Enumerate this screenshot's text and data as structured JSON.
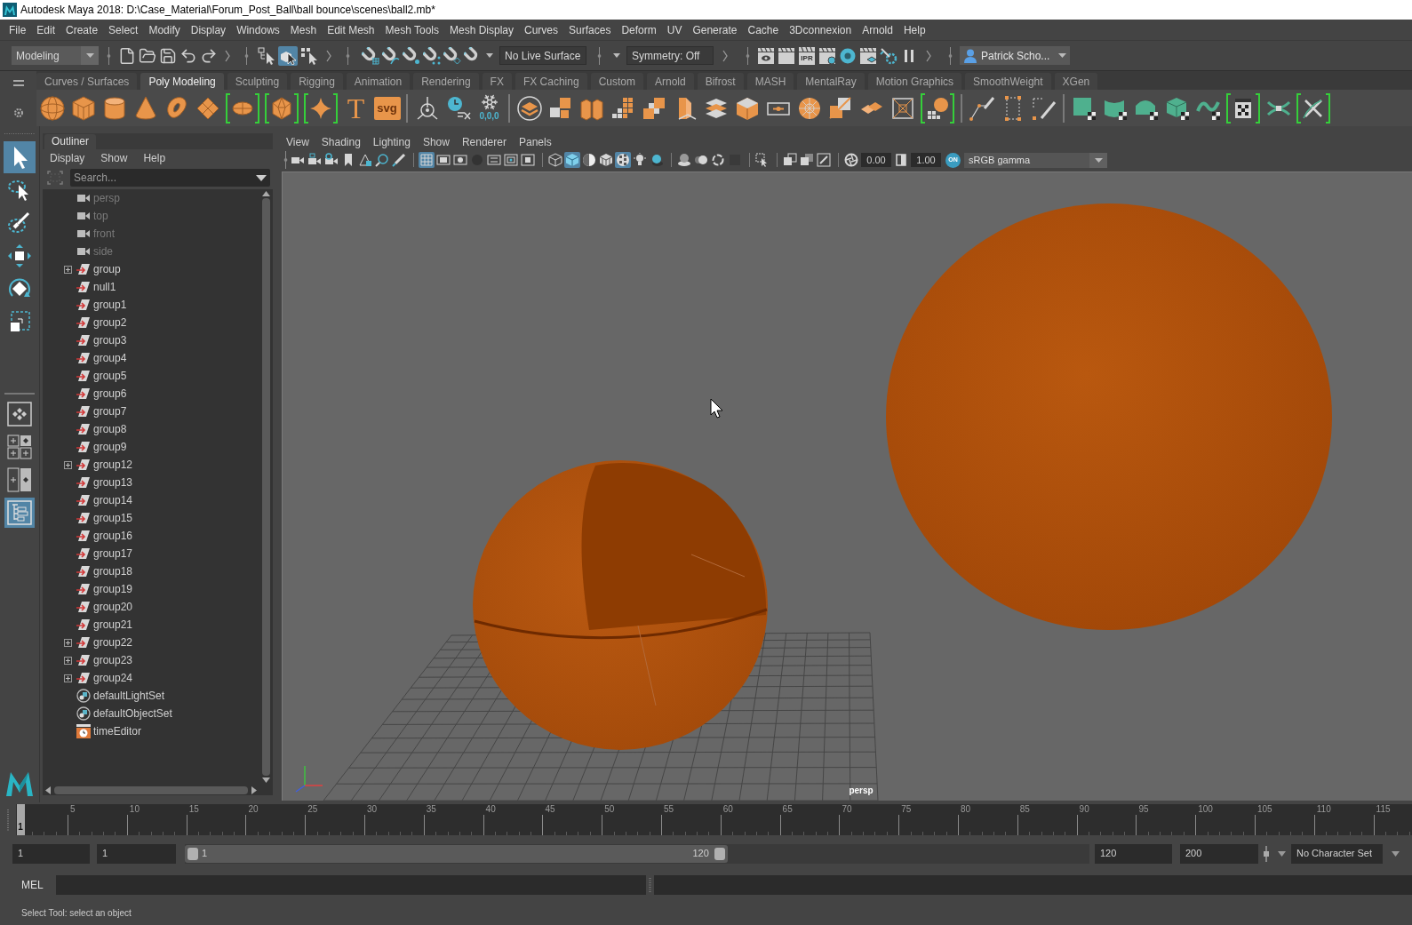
{
  "window": {
    "title": "Autodesk Maya 2018: D:\\Case_Material\\Forum_Post_Ball\\ball bounce\\scenes\\ball2.mb*"
  },
  "menu_bar": [
    "File",
    "Edit",
    "Create",
    "Select",
    "Modify",
    "Display",
    "Windows",
    "Mesh",
    "Edit Mesh",
    "Mesh Tools",
    "Mesh Display",
    "Curves",
    "Surfaces",
    "Deform",
    "UV",
    "Generate",
    "Cache",
    "3Dconnexion",
    "Arnold",
    "Help"
  ],
  "status_line": {
    "menu_set": "Modeling",
    "selection_modes": [
      {
        "selected": false
      },
      {
        "selected": true
      },
      {
        "selected": false
      }
    ],
    "live_surface": "No Live Surface",
    "symmetry": "Symmetry: Off",
    "ipr_label": "IPR",
    "user": "Patrick Scho..."
  },
  "shelf": {
    "tabs": [
      {
        "label": "Curves / Surfaces",
        "selected": false
      },
      {
        "label": "Poly Modeling",
        "selected": true
      },
      {
        "label": "Sculpting",
        "selected": false
      },
      {
        "label": "Rigging",
        "selected": false
      },
      {
        "label": "Animation",
        "selected": false
      },
      {
        "label": "Rendering",
        "selected": false
      },
      {
        "label": "FX",
        "selected": false
      },
      {
        "label": "FX Caching",
        "selected": false
      },
      {
        "label": "Custom",
        "selected": false
      },
      {
        "label": "Arnold",
        "selected": false
      },
      {
        "label": "Bifrost",
        "selected": false
      },
      {
        "label": "MASH",
        "selected": false
      },
      {
        "label": "MentalRay",
        "selected": false
      },
      {
        "label": "Motion Graphics",
        "selected": false
      },
      {
        "label": "SmoothWeight",
        "selected": false
      },
      {
        "label": "XGen",
        "selected": false
      }
    ],
    "button_labels": [
      "T",
      "svg",
      "0,0,0"
    ]
  },
  "toolbox": {
    "tools": [
      {
        "selected": true
      },
      {
        "selected": false
      },
      {
        "selected": false
      },
      {
        "selected": false
      },
      {
        "selected": false
      },
      {
        "selected": false
      }
    ],
    "layouts": [
      {
        "selected": false
      },
      {
        "selected": false
      },
      {
        "selected": false
      },
      {
        "selected": true
      }
    ]
  },
  "outliner": {
    "title": "Outliner",
    "menu": [
      "Display",
      "Show",
      "Help"
    ],
    "search": {
      "placeholder": "Search..."
    },
    "items": [
      {
        "label": "persp",
        "kind": "camera",
        "dimmed": true,
        "expandable": false
      },
      {
        "label": "top",
        "kind": "camera",
        "dimmed": true,
        "expandable": false
      },
      {
        "label": "front",
        "kind": "camera",
        "dimmed": true,
        "expandable": false
      },
      {
        "label": "side",
        "kind": "camera",
        "dimmed": true,
        "expandable": false
      },
      {
        "label": "group",
        "kind": "group",
        "dimmed": false,
        "expandable": true
      },
      {
        "label": "null1",
        "kind": "group",
        "dimmed": false,
        "expandable": false
      },
      {
        "label": "group1",
        "kind": "group",
        "dimmed": false,
        "expandable": false
      },
      {
        "label": "group2",
        "kind": "group",
        "dimmed": false,
        "expandable": false
      },
      {
        "label": "group3",
        "kind": "group",
        "dimmed": false,
        "expandable": false
      },
      {
        "label": "group4",
        "kind": "group",
        "dimmed": false,
        "expandable": false
      },
      {
        "label": "group5",
        "kind": "group",
        "dimmed": false,
        "expandable": false
      },
      {
        "label": "group6",
        "kind": "group",
        "dimmed": false,
        "expandable": false
      },
      {
        "label": "group7",
        "kind": "group",
        "dimmed": false,
        "expandable": false
      },
      {
        "label": "group8",
        "kind": "group",
        "dimmed": false,
        "expandable": false
      },
      {
        "label": "group9",
        "kind": "group",
        "dimmed": false,
        "expandable": false
      },
      {
        "label": "group12",
        "kind": "group",
        "dimmed": false,
        "expandable": true
      },
      {
        "label": "group13",
        "kind": "group",
        "dimmed": false,
        "expandable": false
      },
      {
        "label": "group14",
        "kind": "group",
        "dimmed": false,
        "expandable": false
      },
      {
        "label": "group15",
        "kind": "group",
        "dimmed": false,
        "expandable": false
      },
      {
        "label": "group16",
        "kind": "group",
        "dimmed": false,
        "expandable": false
      },
      {
        "label": "group17",
        "kind": "group",
        "dimmed": false,
        "expandable": false
      },
      {
        "label": "group18",
        "kind": "group",
        "dimmed": false,
        "expandable": false
      },
      {
        "label": "group19",
        "kind": "group",
        "dimmed": false,
        "expandable": false
      },
      {
        "label": "group20",
        "kind": "group",
        "dimmed": false,
        "expandable": false
      },
      {
        "label": "group21",
        "kind": "group",
        "dimmed": false,
        "expandable": false
      },
      {
        "label": "group22",
        "kind": "group",
        "dimmed": false,
        "expandable": true
      },
      {
        "label": "group23",
        "kind": "group",
        "dimmed": false,
        "expandable": true
      },
      {
        "label": "group24",
        "kind": "group",
        "dimmed": false,
        "expandable": true
      },
      {
        "label": "defaultLightSet",
        "kind": "set",
        "dimmed": false,
        "expandable": false
      },
      {
        "label": "defaultObjectSet",
        "kind": "set",
        "dimmed": false,
        "expandable": false
      },
      {
        "label": "timeEditor",
        "kind": "time_editor",
        "dimmed": false,
        "expandable": false
      }
    ]
  },
  "viewport": {
    "menu": [
      "View",
      "Shading",
      "Lighting",
      "Show",
      "Renderer",
      "Panels"
    ],
    "toolbar": {
      "toggles": [
        {
          "on": false
        },
        {
          "on": false
        },
        {
          "on": false
        },
        {
          "on": false
        },
        {
          "on": false
        },
        {
          "on": false
        },
        {
          "on": false
        },
        {
          "on": true
        },
        {
          "on": false
        },
        {
          "on": false
        },
        {
          "on": false
        },
        {
          "on": false
        },
        {
          "on": false
        },
        {
          "on": false
        },
        {
          "on": false
        },
        {
          "on": true
        },
        {
          "on": false
        },
        {
          "on": false
        },
        {
          "on": true
        },
        {
          "on": false
        },
        {
          "on": false
        },
        {
          "on": false
        },
        {
          "on": false
        },
        {
          "on": false
        },
        {
          "on": false
        },
        {
          "on": false
        },
        {
          "on": false
        },
        {
          "on": false
        },
        {
          "on": false
        }
      ],
      "exposure": "0.00",
      "gamma": "1.00",
      "color_management": {
        "on": true,
        "label": "ON"
      },
      "color_space": "sRGB gamma"
    },
    "camera": "persp"
  },
  "time_slider": {
    "current_frame": "1",
    "level": 0,
    "tick_labels": [
      "5",
      "10",
      "15",
      "20",
      "25",
      "30",
      "35",
      "40",
      "45",
      "50",
      "55",
      "60",
      "65",
      "70",
      "75",
      "80",
      "85",
      "90",
      "95",
      "100",
      "105",
      "110",
      "115"
    ]
  },
  "range_slider": {
    "animation_start": "1",
    "playback_start": "1",
    "range_start": "1",
    "range_end": "120",
    "level": 0.6,
    "playback_end": "120",
    "animation_end": "200",
    "character_set": "No Character Set"
  },
  "command_line": {
    "language": "MEL"
  },
  "help_line": "Select Tool: select an object"
}
